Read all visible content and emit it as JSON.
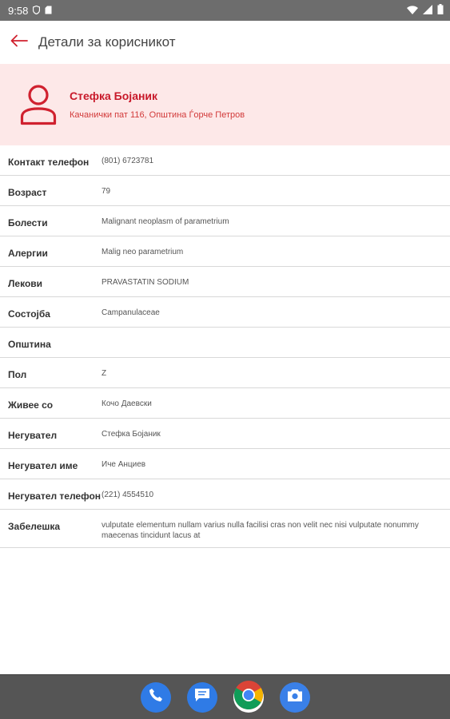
{
  "status": {
    "time": "9:58",
    "icons": [
      "shield-icon",
      "sd-card-icon",
      "wifi-icon",
      "cell-signal-icon",
      "battery-icon"
    ]
  },
  "appbar": {
    "title": "Детали за корисникот",
    "back_icon": "arrow-back-icon"
  },
  "colors": {
    "accent": "#d0212f",
    "header_bg": "#fde8e8",
    "statusbar": "#6d6d6d",
    "navbar": "#555555"
  },
  "user": {
    "name": "Стефка Бојаник",
    "address": "Качанички пат 116, Општина Ѓорче Петров"
  },
  "details": [
    {
      "label": "Контакт телефон",
      "value": "(801) 6723781"
    },
    {
      "label": "Возраст",
      "value": "79"
    },
    {
      "label": "Болести",
      "value": "Malignant neoplasm of parametrium"
    },
    {
      "label": "Алергии",
      "value": "Malig neo parametrium"
    },
    {
      "label": "Лекови",
      "value": "PRAVASTATIN SODIUM"
    },
    {
      "label": "Состојба",
      "value": "Campanulaceae"
    },
    {
      "label": "Општина",
      "value": ""
    },
    {
      "label": "Пол",
      "value": "Z"
    },
    {
      "label": "Живее со",
      "value": "Кочо Даевски"
    },
    {
      "label": "Негувател",
      "value": "Стефка Бојаник"
    },
    {
      "label": "Негувател име",
      "value": "Иче Анциев"
    },
    {
      "label": "Негувател телефон",
      "value": "(221) 4554510"
    },
    {
      "label": "Забелешка",
      "value": "vulputate elementum nullam varius nulla facilisi cras non velit nec nisi vulputate nonummy maecenas tincidunt lacus at"
    }
  ],
  "dock": [
    "phone-icon",
    "messages-icon",
    "chrome-icon",
    "camera-icon"
  ]
}
